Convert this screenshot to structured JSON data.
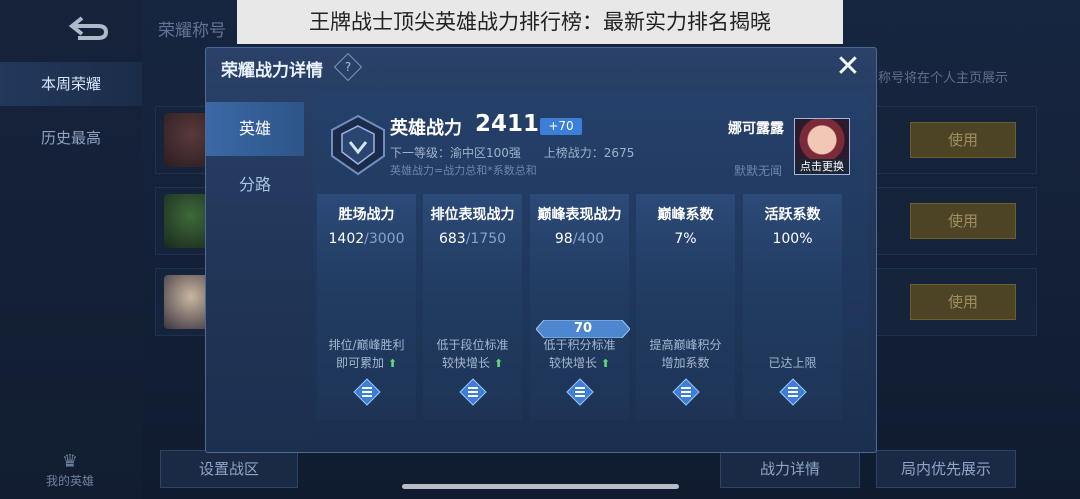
{
  "caption": "王牌战士顶尖英雄战力排行榜：最新实力排名揭晓",
  "background": {
    "left_tabs": [
      "本周荣耀",
      "历史最高"
    ],
    "my_hero": "我的英雄",
    "page_title": "荣耀称号",
    "hint": "称号将在个人主页展示",
    "use_label": "使用",
    "bottom_buttons": [
      "设置战区",
      "战力详情",
      "局内优先展示"
    ]
  },
  "modal": {
    "title": "荣耀战力详情",
    "side_tabs": [
      "英雄",
      "分路"
    ],
    "power_label": "英雄战力",
    "power_value": "2411",
    "power_delta": "+70",
    "next_level": "下一等级：渝中区100强",
    "list_power": "上榜战力：2675",
    "formula": "英雄战力=战力总和*系数总和",
    "hero_name": "娜可露露",
    "hero_sub": "默默无闻",
    "portrait_button": "点击更换",
    "peak_bonus": "70",
    "columns": [
      {
        "title": "胜场战力",
        "value": "1402",
        "max": "/3000",
        "note1": "排位/巅峰胜利",
        "note2": "即可累加",
        "arrow": true
      },
      {
        "title": "排位表现战力",
        "value": "683",
        "max": "/1750",
        "note1": "低于段位标准",
        "note2": "较快增长",
        "arrow": true
      },
      {
        "title": "巅峰表现战力",
        "value": "98",
        "max": "/400",
        "note1": "低于积分标准",
        "note2": "较快增长",
        "arrow": true
      },
      {
        "title": "巅峰系数",
        "value": "7%",
        "max": "",
        "note1": "提高巅峰积分",
        "note2": "增加系数",
        "arrow": false
      },
      {
        "title": "活跃系数",
        "value": "100%",
        "max": "",
        "note1": "",
        "note2": "已达上限",
        "arrow": false
      }
    ]
  },
  "colors": {
    "accent": "#3b7fd9",
    "use_button": "#4d4426",
    "up_arrow": "#5ede7a"
  }
}
